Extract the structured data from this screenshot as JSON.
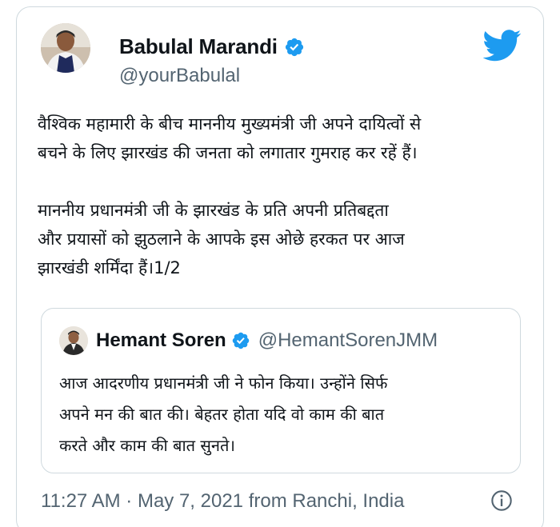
{
  "author": {
    "name": "Babulal Marandi",
    "handle": "@yourBabulal"
  },
  "tweet": {
    "text": "वैश्विक महामारी के बीच माननीय मुख्यमंत्री जी अपने दायित्वों से\nबचने के लिए झारखंड की जनता को लगातार गुमराह कर रहें हैं।\n\nमाननीय प्रधानमंत्री जी के झारखंड के प्रति अपनी प्रतिबद्दता\nऔर प्रयासों को झुठलाने के आपके इस ओछे हरकत पर आज\nझारखंडी शर्मिंदा हैं।1/2"
  },
  "quoted": {
    "name": "Hemant Soren",
    "handle": "@HemantSorenJMM",
    "text": "आज आदरणीय प्रधानमंत्री जी ने फोन किया। उन्होंने सिर्फ\nअपने मन की बात की। बेहतर होता यदि वो काम की बात\nकरते और काम की बात सुनते।"
  },
  "meta": {
    "timestamp": "11:27 AM · May 7, 2021 from Ranchi, India"
  },
  "icons": {
    "verified": "verified-badge-icon",
    "brand": "twitter-bird-icon",
    "info": "info-icon"
  },
  "colors": {
    "twitter_blue": "#1d9bf0",
    "text_secondary": "#536471",
    "border": "#cfd9de"
  }
}
